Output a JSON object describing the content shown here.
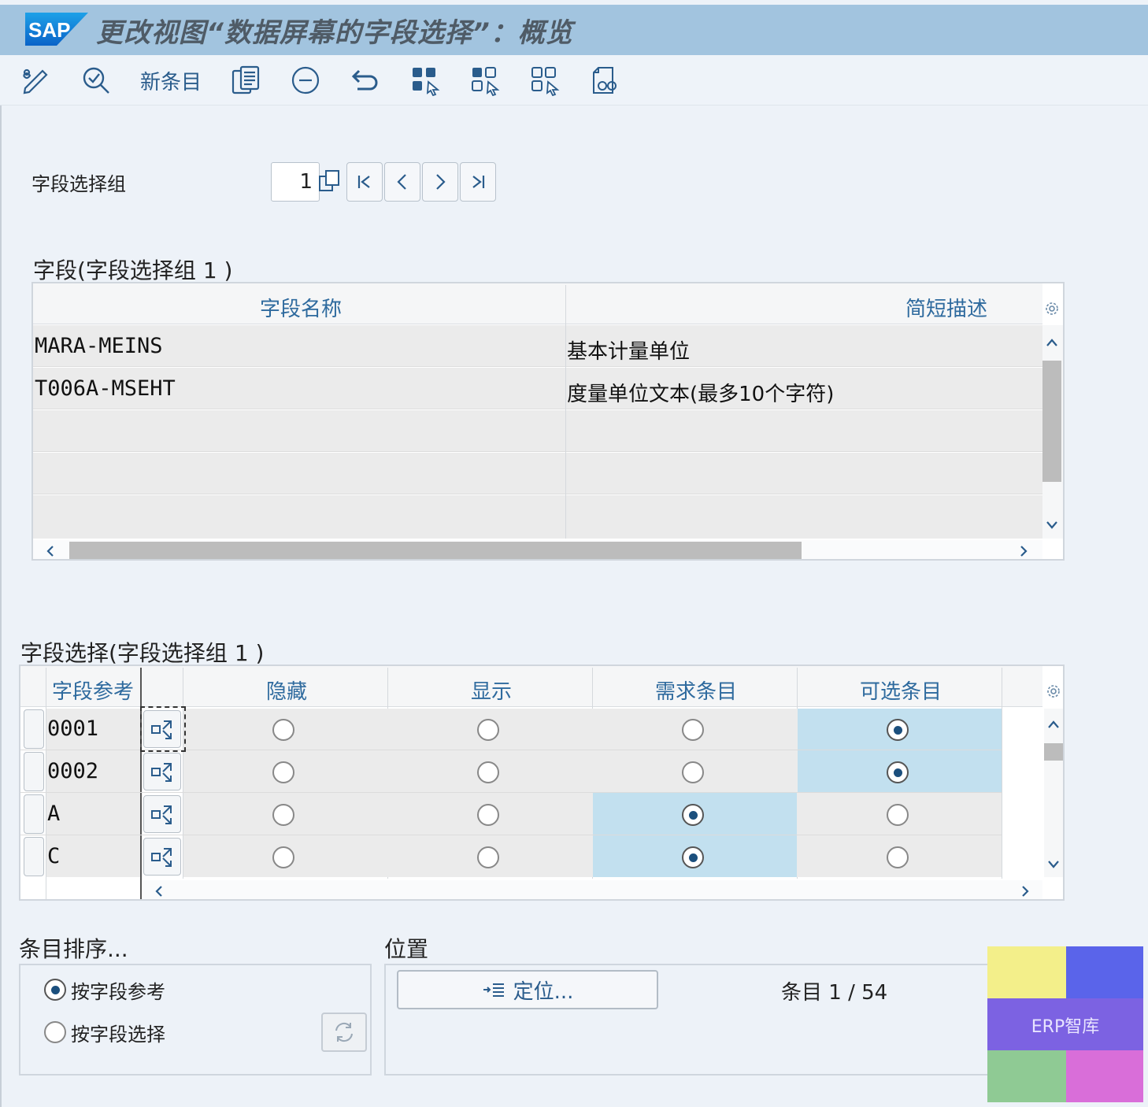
{
  "window": {
    "logo_text": "SAP",
    "title": "更改视图“数据屏幕的字段选择”：概览"
  },
  "toolbar": {
    "icons": [
      "change-display-icon",
      "check-icon",
      "new-entries",
      "copy-icon",
      "delete-icon",
      "undo-icon",
      "select-all-icon",
      "select-block-icon",
      "deselect-all-icon",
      "print-preview-icon"
    ],
    "new_entries_label": "新条目"
  },
  "group_selector": {
    "label": "字段选择组",
    "value": "1"
  },
  "fields_table": {
    "title": "字段(字段选择组    1 )",
    "headers": {
      "field_name": "字段名称",
      "short_desc": "简短描述"
    },
    "rows": [
      {
        "field": "MARA-MEINS",
        "desc": "基本计量单位"
      },
      {
        "field": "T006A-MSEHT",
        "desc": "度量单位文本(最多10个字符)"
      },
      {
        "field": "",
        "desc": ""
      },
      {
        "field": "",
        "desc": ""
      },
      {
        "field": "",
        "desc": ""
      }
    ]
  },
  "selection_table": {
    "title": "字段选择(字段选择组    1 )",
    "headers": {
      "ref": "字段参考",
      "hide": "隐藏",
      "display": "显示",
      "required": "需求条目",
      "optional": "可选条目"
    },
    "rows": [
      {
        "ref": "0001",
        "selected": "optional"
      },
      {
        "ref": "0002",
        "selected": "optional"
      },
      {
        "ref": "A",
        "selected": "required"
      },
      {
        "ref": "C",
        "selected": "required"
      }
    ]
  },
  "sort_box": {
    "title": "条目排序...",
    "options": [
      "按字段参考",
      "按字段选择"
    ],
    "selected_index": 0
  },
  "position_box": {
    "title": "位置",
    "locate_label": "定位...",
    "entry_label": "条目",
    "entry_current": "1",
    "entry_total": "54"
  },
  "watermark": {
    "text": "ERP智库"
  },
  "colors": {
    "title_bar": "#a2c4df",
    "accent": "#2a5c8c",
    "selected_cell": "#c2e0ef"
  }
}
